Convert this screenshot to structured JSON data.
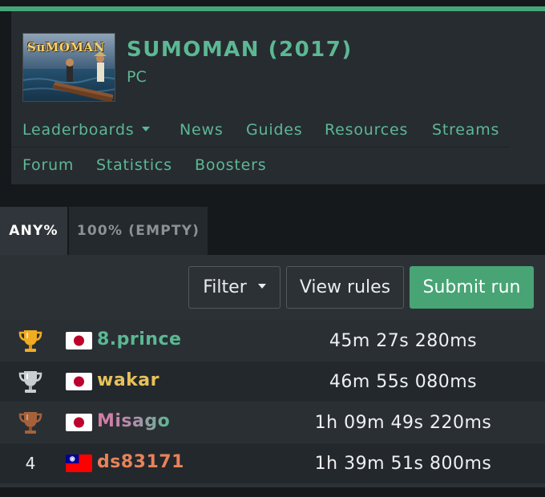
{
  "accent_color": "#46a577",
  "game": {
    "title": "SUMOMAN (2017)",
    "platform": "PC",
    "cover_logo_text": "SuMOMAN"
  },
  "nav": {
    "row1": [
      {
        "label": "Leaderboards",
        "has_dropdown": true
      },
      {
        "label": "News"
      },
      {
        "label": "Guides"
      },
      {
        "label": "Resources"
      },
      {
        "label": "Streams"
      }
    ],
    "row2": [
      {
        "label": "Forum"
      },
      {
        "label": "Statistics"
      },
      {
        "label": "Boosters"
      }
    ]
  },
  "categories": [
    {
      "label": "ANY%",
      "selected": true
    },
    {
      "label": "100% (EMPTY)",
      "selected": false
    }
  ],
  "toolbar": {
    "filter_label": "Filter",
    "rules_label": "View rules",
    "submit_label": "Submit run"
  },
  "runs": [
    {
      "rank": "1",
      "rank_icon": "gold-trophy-icon",
      "country": "japan-flag-icon",
      "player": "8.prince",
      "player_color": "#5cb893",
      "time": "45m 27s 280ms"
    },
    {
      "rank": "2",
      "rank_icon": "silver-trophy-icon",
      "country": "japan-flag-icon",
      "player": "wakar",
      "player_color": "#e7c25a",
      "time": "46m 55s 080ms"
    },
    {
      "rank": "3",
      "rank_icon": "bronze-trophy-icon",
      "country": "japan-flag-icon",
      "player": "Misago",
      "player_color": "gradient #d77aa8 to #5cb893",
      "time": "1h 09m 49s 220ms"
    },
    {
      "rank": "4",
      "rank_icon": "",
      "country": "taiwan-flag-icon",
      "player": "ds83171",
      "player_color": "#e8825a",
      "time": "1h 39m 51s 800ms"
    }
  ]
}
